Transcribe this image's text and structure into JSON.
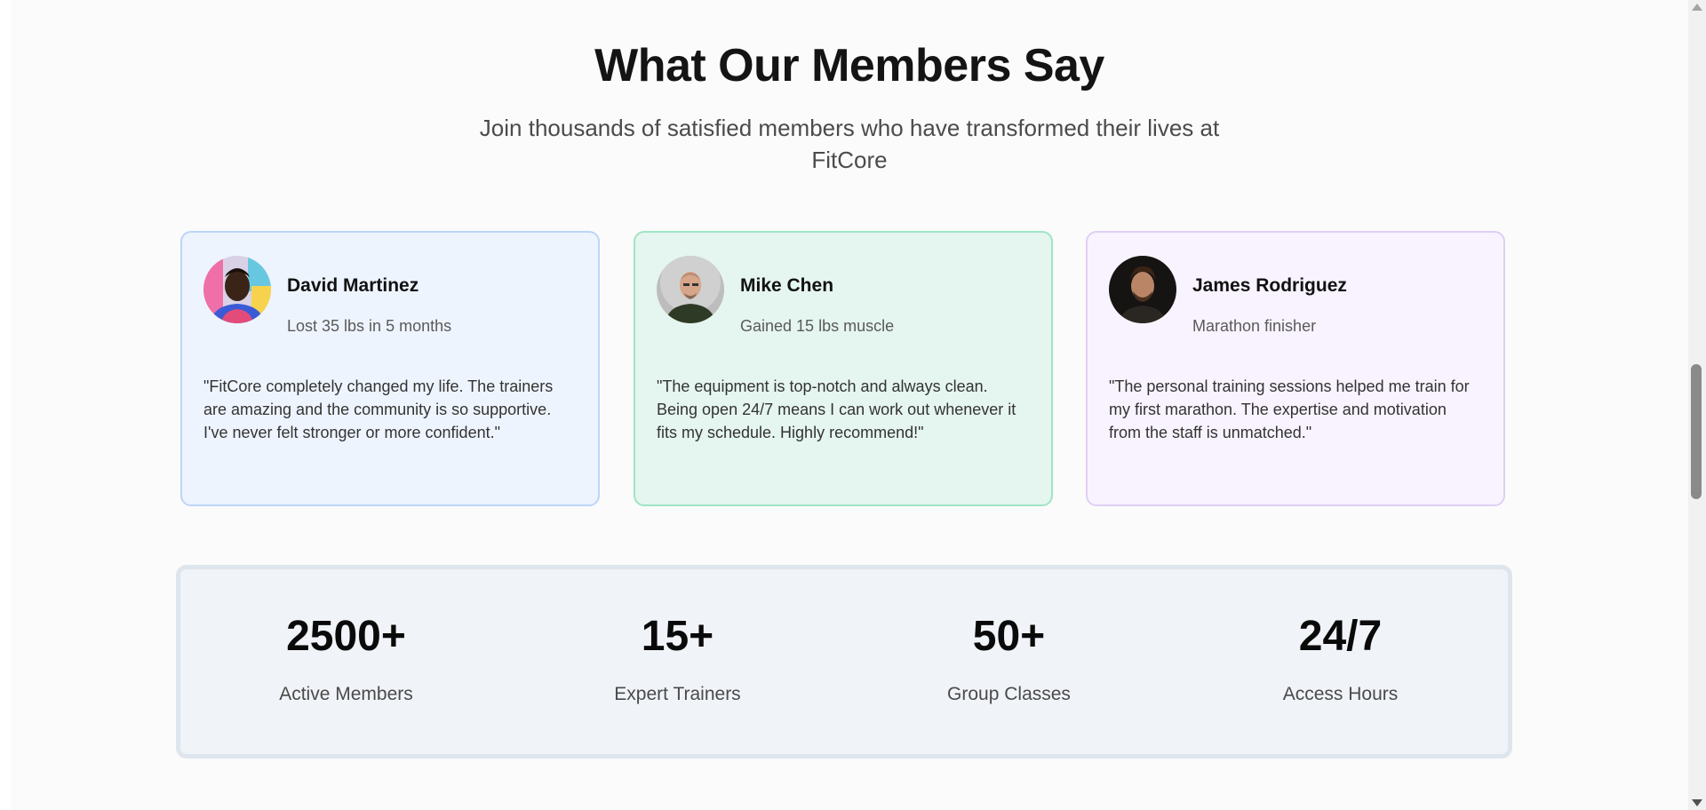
{
  "section": {
    "title": "What Our Members Say",
    "subtitle": "Join thousands of satisfied members who have transformed their lives at FitCore"
  },
  "testimonials": [
    {
      "name": "David Martinez",
      "achievement": "Lost 35 lbs in 5 months",
      "quote": "\"FitCore completely changed my life. The trainers are amazing and the community is so supportive. I've never felt stronger or more confident.\"",
      "accent": "#bcd5f7"
    },
    {
      "name": "Mike Chen",
      "achievement": "Gained 15 lbs muscle",
      "quote": "\"The equipment is top-notch and always clean. Being open 24/7 means I can work out whenever it fits my schedule. Highly recommend!\"",
      "accent": "#9fe5c5"
    },
    {
      "name": "James Rodriguez",
      "achievement": "Marathon finisher",
      "quote": "\"The personal training sessions helped me train for my first marathon. The expertise and motivation from the staff is unmatched.\"",
      "accent": "#e0cff5"
    }
  ],
  "stats": [
    {
      "value": "2500+",
      "label": "Active Members"
    },
    {
      "value": "15+",
      "label": "Expert Trainers"
    },
    {
      "value": "50+",
      "label": "Group Classes"
    },
    {
      "value": "24/7",
      "label": "Access Hours"
    }
  ],
  "icons": {
    "scroll_up": "triangle-up-icon",
    "scroll_down": "triangle-down-icon"
  }
}
